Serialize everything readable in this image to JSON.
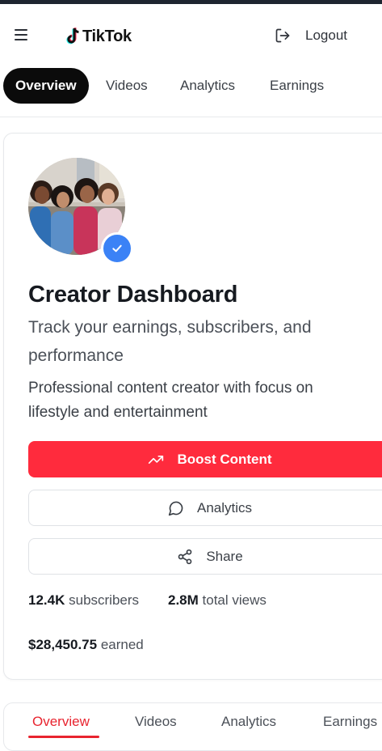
{
  "header": {
    "brand": "TikTok",
    "logout_label": "Logout"
  },
  "tabs": [
    {
      "label": "Overview",
      "active": true
    },
    {
      "label": "Videos",
      "active": false
    },
    {
      "label": "Analytics",
      "active": false
    },
    {
      "label": "Earnings",
      "active": false
    }
  ],
  "profile": {
    "title": "Creator Dashboard",
    "subtitle": "Track your earnings, subscribers, and performance",
    "description": "Professional content creator with focus on lifestyle and entertainment",
    "verified": true
  },
  "actions": {
    "boost_label": "Boost Content",
    "analytics_label": "Analytics",
    "share_label": "Share"
  },
  "stats": {
    "subscribers_value": "12.4K",
    "subscribers_label": "subscribers",
    "views_value": "2.8M",
    "views_label": "total views",
    "earned_value": "$28,450.75",
    "earned_label": "earned"
  },
  "bottom_tabs": [
    {
      "label": "Overview",
      "active": true
    },
    {
      "label": "Videos",
      "active": false
    },
    {
      "label": "Analytics",
      "active": false
    },
    {
      "label": "Earnings",
      "active": false
    }
  ],
  "colors": {
    "accent": "#ff2b3d",
    "verified": "#3b82f6",
    "active_tab_bg": "#0b0b0b"
  }
}
